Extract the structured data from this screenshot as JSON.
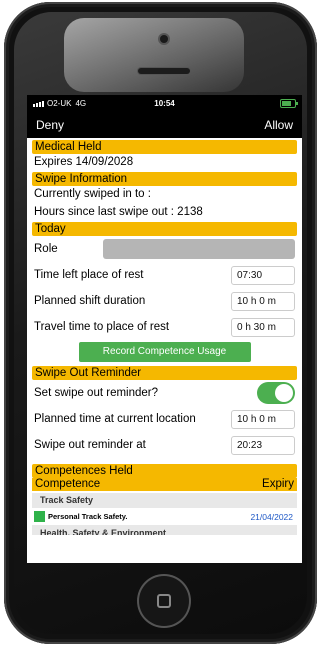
{
  "status_bar": {
    "carrier": "O2-UK",
    "network": "4G",
    "time": "10:54"
  },
  "nav": {
    "left": "Deny",
    "right": "Allow"
  },
  "medical": {
    "header": "Medical Held",
    "expires": "Expires 14/09/2028"
  },
  "swipe_info": {
    "header": "Swipe Information",
    "line1": "Currently swiped in to :",
    "line2": "Hours since last swipe out : 2138"
  },
  "today": {
    "header": "Today",
    "role_label": "Role",
    "time_left_label": "Time left place of rest",
    "time_left_value": "07:30",
    "shift_label": "Planned shift duration",
    "shift_value": "10 h  0 m",
    "travel_label": "Travel time to place of rest",
    "travel_value": "0 h 30 m",
    "record_button": "Record Competence Usage"
  },
  "reminder": {
    "header": "Swipe Out Reminder",
    "set_label": "Set swipe out reminder?",
    "set_on": true,
    "planned_label": "Planned time at current location",
    "planned_value": "10 h  0 m",
    "at_label": "Swipe out reminder at",
    "at_value": "20:23"
  },
  "competences": {
    "header": "Competences Held",
    "col_competence": "Competence",
    "col_expiry": "Expiry",
    "groups": [
      {
        "title": "Track Safety",
        "items": [
          {
            "name": "Personal Track Safety.",
            "expiry": "21/04/2022",
            "status_color": "#2fb24a"
          }
        ]
      },
      {
        "title": "Health, Safety & Environment",
        "items": []
      }
    ]
  },
  "colors": {
    "accent": "#f5b800",
    "green": "#4caf50",
    "link": "#1f59c6"
  },
  "device": {
    "home_icon": "home-button-icon"
  }
}
